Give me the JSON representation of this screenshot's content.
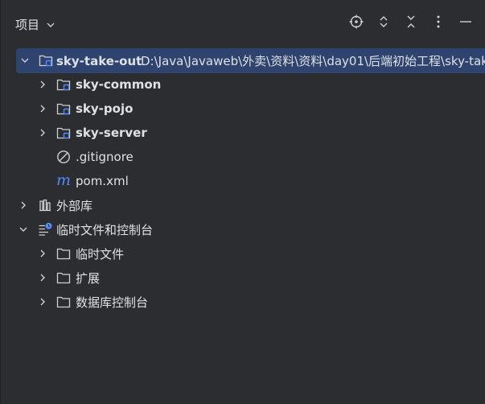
{
  "header": {
    "title": "项目",
    "toolbar": [
      "locate-icon",
      "expand-all-icon",
      "collapse-all-icon",
      "more-options-icon",
      "hide-panel-icon"
    ]
  },
  "tree": {
    "root": {
      "name": "sky-take-out",
      "path": "D:\\Java\\Javaweb\\外卖\\资料\\资料\\day01\\后端初始工程\\sky-tak"
    },
    "modules": [
      {
        "name": "sky-common"
      },
      {
        "name": "sky-pojo"
      },
      {
        "name": "sky-server"
      }
    ],
    "files": [
      {
        "name": ".gitignore",
        "icon": "ignore-icon"
      },
      {
        "name": "pom.xml",
        "icon": "maven-icon"
      }
    ],
    "external_libraries": "外部库",
    "scratches": {
      "label": "临时文件和控制台",
      "children": [
        "临时文件",
        "扩展",
        "数据库控制台"
      ]
    }
  },
  "colors": {
    "background": "#2b2d30",
    "selection": "#2e436e",
    "text": "#dfe1e5",
    "icon": "#ced0d6",
    "module_accent": "#548af7",
    "maven": "#548af7"
  }
}
